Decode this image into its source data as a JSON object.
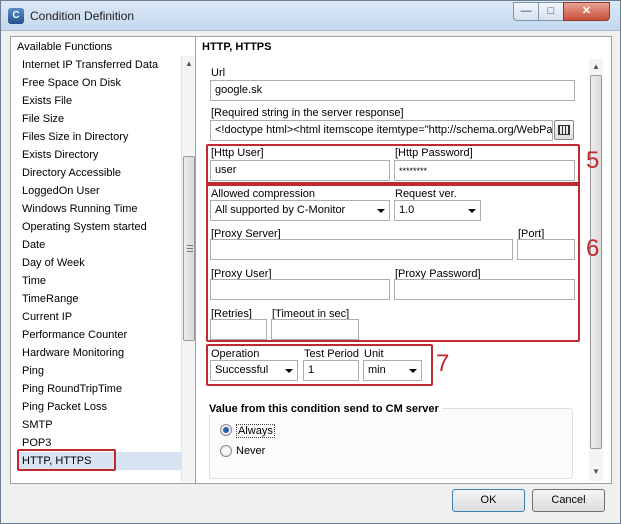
{
  "window": {
    "title": "Condition Definition",
    "icon": "app-icon"
  },
  "left_panel": {
    "heading": "Available Functions",
    "items": [
      "Internet IP Transferred Data",
      "Free Space On Disk",
      "Exists File",
      "File Size",
      "Files Size in Directory",
      "Exists Directory",
      "Directory Accessible",
      "LoggedOn User",
      "Windows Running Time",
      "Operating System started",
      "Date",
      "Day of Week",
      "Time",
      "TimeRange",
      "Current IP",
      "Performance Counter",
      "Hardware Monitoring",
      "Ping",
      "Ping RoundTripTime",
      "Ping Packet Loss",
      "SMTP",
      "POP3",
      "HTTP, HTTPS"
    ],
    "selected": "HTTP, HTTPS"
  },
  "right_panel": {
    "heading": "HTTP, HTTPS",
    "url": {
      "label": "Url",
      "value": "google.sk"
    },
    "required_string": {
      "label": "[Required string in the server response]",
      "value": "<!doctype html><html itemscope itemtype=\"http://schema.org/WebPag"
    },
    "http_user": {
      "label": "[Http User]",
      "value": "user"
    },
    "http_password": {
      "label": "[Http Password]",
      "value": "********"
    },
    "compression": {
      "label": "Allowed compression",
      "value": "All supported by C-Monitor"
    },
    "request_ver": {
      "label": "Request ver.",
      "value": "1.0"
    },
    "proxy_server": {
      "label": "[Proxy Server]",
      "value": ""
    },
    "port": {
      "label": "[Port]",
      "value": ""
    },
    "proxy_user": {
      "label": "[Proxy User]",
      "value": ""
    },
    "proxy_password": {
      "label": "[Proxy Password]",
      "value": ""
    },
    "retries": {
      "label": "[Retries]",
      "value": ""
    },
    "timeout": {
      "label": "[Timeout in sec]",
      "value": ""
    },
    "operation": {
      "label": "Operation",
      "value": "Successful"
    },
    "test_period": {
      "label": "Test Period",
      "value": "1"
    },
    "unit": {
      "label": "Unit",
      "value": "min"
    },
    "value_group": {
      "title": "Value from this condition send to CM server",
      "always": "Always",
      "never": "Never",
      "selected": "Always"
    }
  },
  "annotations": {
    "box5": "5",
    "box6": "6",
    "box7": "7"
  },
  "buttons": {
    "ok": "OK",
    "cancel": "Cancel"
  },
  "colors": {
    "annotation_red": "#c0292e",
    "selection": "#d8e4f2"
  }
}
